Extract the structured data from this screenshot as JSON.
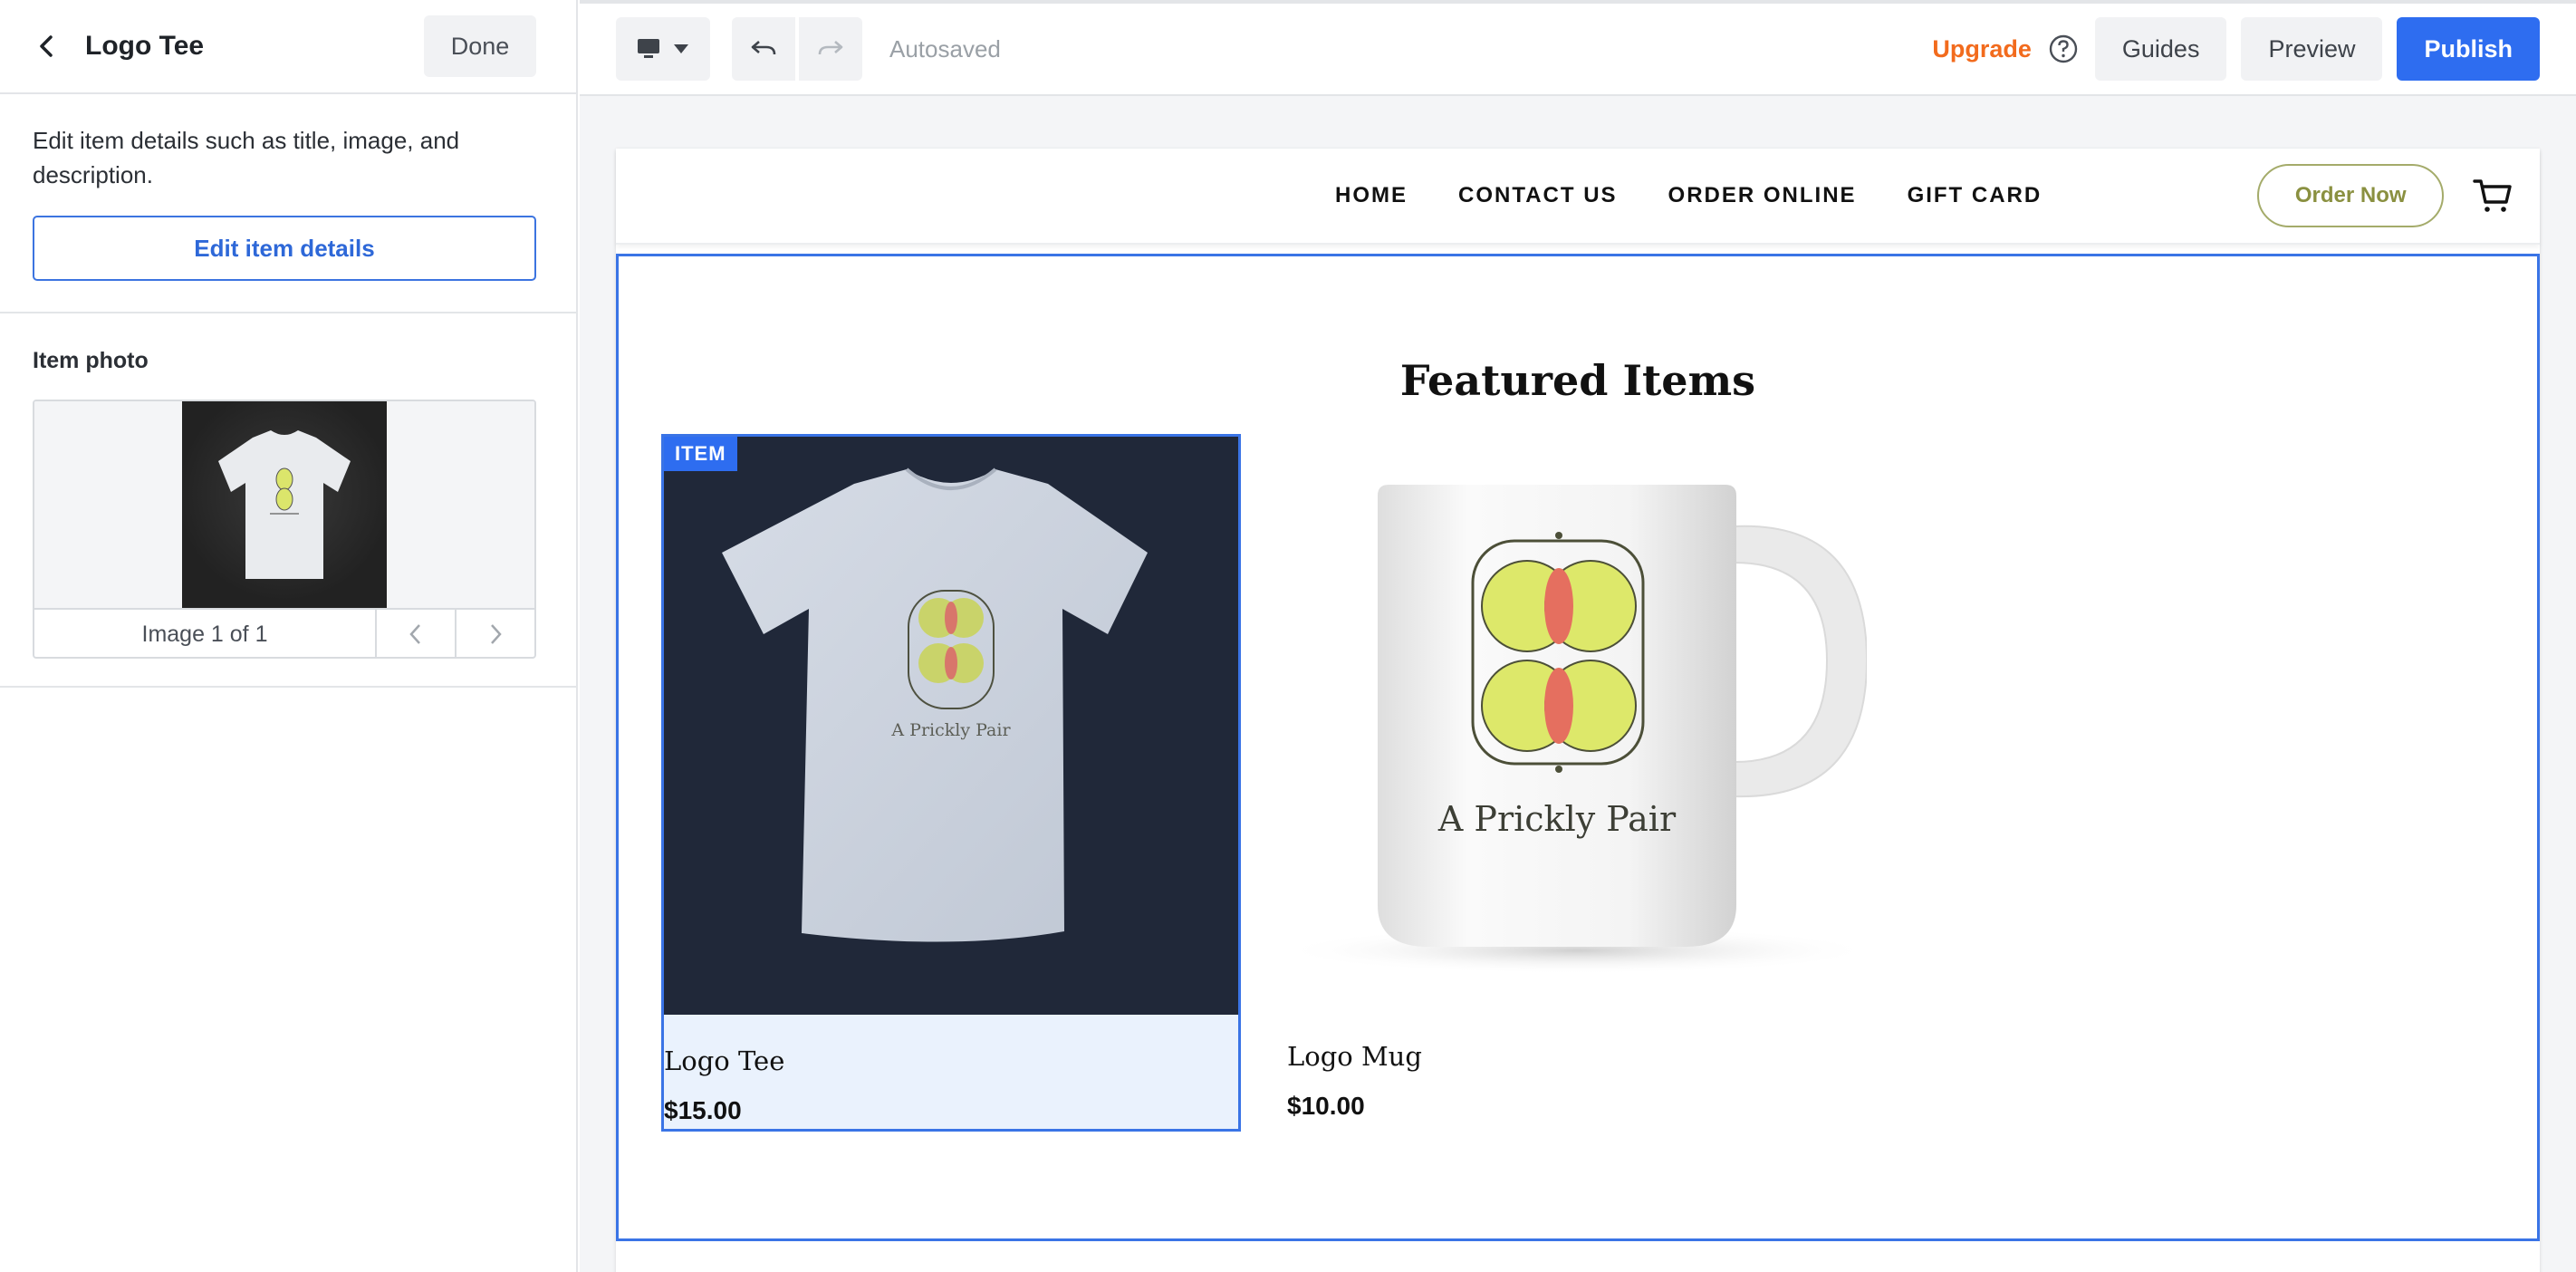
{
  "panel": {
    "title": "Logo Tee",
    "done_label": "Done",
    "description": "Edit item details such as title, image, and description.",
    "edit_label": "Edit item details",
    "photo_label": "Item photo",
    "image_count": "Image 1 of 1"
  },
  "toolbar": {
    "autosaved": "Autosaved",
    "upgrade": "Upgrade",
    "guides": "Guides",
    "preview": "Preview",
    "publish": "Publish"
  },
  "site": {
    "nav": [
      "HOME",
      "CONTACT US",
      "ORDER ONLINE",
      "GIFT CARD"
    ],
    "order_now": "Order Now",
    "section_title": "Featured Items",
    "badge": "ITEM",
    "items": [
      {
        "name": "Logo Tee",
        "price": "$15.00"
      },
      {
        "name": "Logo Mug",
        "price": "$10.00"
      }
    ],
    "logo_text": "A Prickly Pair"
  },
  "colors": {
    "accent": "#2e6df0",
    "upgrade": "#f26b1d",
    "order_now": "#8a9040",
    "logo_fill": "#dde86a",
    "logo_inner": "#e56f5f"
  }
}
